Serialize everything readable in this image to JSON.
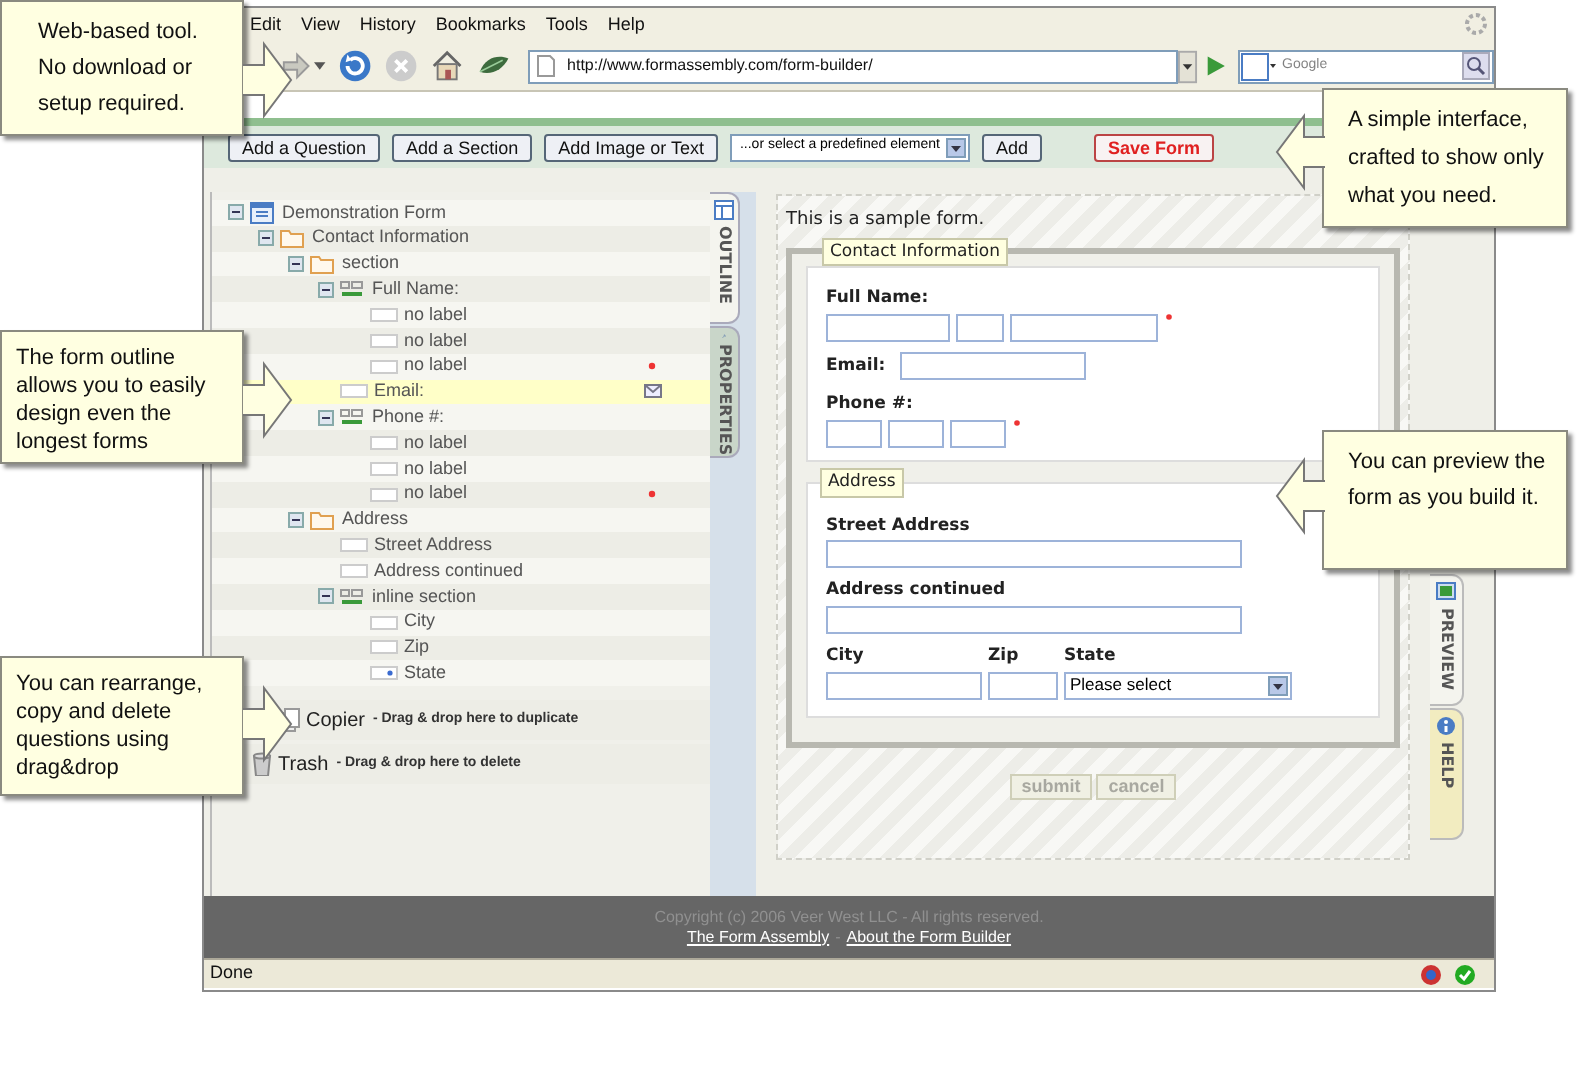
{
  "browser": {
    "menu": [
      "Edit",
      "View",
      "History",
      "Bookmarks",
      "Tools",
      "Help"
    ],
    "url": "http://www.formassembly.com/form-builder/",
    "search_placeholder": "Google",
    "status": "Done"
  },
  "toolbar": [
    {
      "kind": "button",
      "label": "Add a Question"
    },
    {
      "kind": "button",
      "label": "Add a Section"
    },
    {
      "kind": "button",
      "label": "Add Image or Text"
    },
    {
      "kind": "select",
      "label": "...or select a predefined element"
    },
    {
      "kind": "button",
      "label": "Add"
    },
    {
      "kind": "save",
      "label": "Save Form"
    }
  ],
  "outline": {
    "tree": [
      {
        "label": "Demonstration Form",
        "kind": "form",
        "selected": false,
        "children": [
          {
            "label": "Contact Information",
            "kind": "folder",
            "selected": false,
            "children": [
              {
                "label": "section",
                "kind": "folder",
                "selected": false,
                "children": [
                  {
                    "label": "Full Name:",
                    "kind": "group",
                    "selected": false,
                    "children": [
                      {
                        "label": "no label",
                        "kind": "field",
                        "selected": false,
                        "required": false,
                        "email": false
                      },
                      {
                        "label": "no label",
                        "kind": "field",
                        "selected": false,
                        "required": false,
                        "email": false
                      },
                      {
                        "label": "no label",
                        "kind": "field",
                        "selected": false,
                        "required": true,
                        "email": false
                      }
                    ]
                  },
                  {
                    "label": "Email:",
                    "kind": "field",
                    "selected": true,
                    "required": false,
                    "email": true
                  },
                  {
                    "label": "Phone #:",
                    "kind": "group",
                    "selected": false,
                    "children": [
                      {
                        "label": "no label",
                        "kind": "field",
                        "selected": false,
                        "required": false,
                        "email": false
                      },
                      {
                        "label": "no label",
                        "kind": "field",
                        "selected": false,
                        "required": false,
                        "email": false
                      },
                      {
                        "label": "no label",
                        "kind": "field",
                        "selected": false,
                        "required": true,
                        "email": false
                      }
                    ]
                  }
                ]
              },
              {
                "label": "Address",
                "kind": "folder",
                "selected": false,
                "children": [
                  {
                    "label": "Street Address",
                    "kind": "field",
                    "selected": false,
                    "required": false,
                    "email": false
                  },
                  {
                    "label": "Address continued",
                    "kind": "field",
                    "selected": false,
                    "required": false,
                    "email": false
                  },
                  {
                    "label": "inline section",
                    "kind": "group",
                    "selected": false,
                    "children": [
                      {
                        "label": "City",
                        "kind": "field",
                        "selected": false,
                        "required": false,
                        "email": false
                      },
                      {
                        "label": "Zip",
                        "kind": "field",
                        "selected": false,
                        "required": false,
                        "email": false
                      },
                      {
                        "label": "State",
                        "kind": "select",
                        "selected": false,
                        "required": false,
                        "email": false
                      }
                    ]
                  }
                ]
              }
            ]
          }
        ]
      }
    ],
    "drop_zones": [
      {
        "kind": "copier",
        "label": "Copier",
        "hint": "- Drag & drop here to duplicate"
      },
      {
        "kind": "trash",
        "label": "Trash",
        "hint": "- Drag & drop here to delete"
      }
    ]
  },
  "left_tabs": [
    {
      "label": "OUTLINE",
      "selected": true
    },
    {
      "label": "PROPERTIES",
      "selected": false
    }
  ],
  "right_tabs": [
    {
      "label": "PREVIEW",
      "selected": true
    },
    {
      "label": "HELP",
      "selected": false
    }
  ],
  "preview": {
    "intro": "This is a sample form.",
    "fieldset": {
      "legend": "Contact Information",
      "questions": [
        {
          "kind": "stacked",
          "label": "Full Name:",
          "required": true
        },
        {
          "kind": "inline",
          "label": "Email:",
          "required": false
        },
        {
          "kind": "stacked",
          "label": "Phone #:",
          "required": true
        }
      ],
      "subsections": [
        {
          "legend": "Address",
          "questions": [
            {
              "kind": "stacked",
              "label": "Street Address",
              "required": false
            },
            {
              "kind": "stacked",
              "label": "Address continued",
              "required": false
            },
            {
              "kind": "columns",
              "columns": [
                {
                  "label": "City",
                  "kind": "text"
                },
                {
                  "label": "Zip",
                  "kind": "text"
                },
                {
                  "label": "State",
                  "kind": "select",
                  "value": "Please select"
                }
              ]
            }
          ]
        }
      ]
    },
    "buttons": [
      {
        "label": "submit",
        "disabled": true
      },
      {
        "label": "cancel",
        "disabled": true
      }
    ]
  },
  "footer": {
    "copyright": "Copyright (c) 2006 Veer West LLC - All rights reserved.",
    "links": [
      "The Form Assembly",
      "About the Form Builder"
    ],
    "separator": "-"
  },
  "callouts": [
    {
      "text": "Web-based tool. No download or setup required.",
      "kind": "right"
    },
    {
      "text": "A simple interface, crafted to show only what you need.",
      "kind": "left"
    },
    {
      "text": "The form outline allows you to easily design even the longest forms",
      "kind": "right"
    },
    {
      "text": "You can preview the form as you build it.",
      "kind": "left"
    },
    {
      "text": "You can rearrange, copy and delete questions using drag&drop",
      "kind": "right"
    }
  ]
}
